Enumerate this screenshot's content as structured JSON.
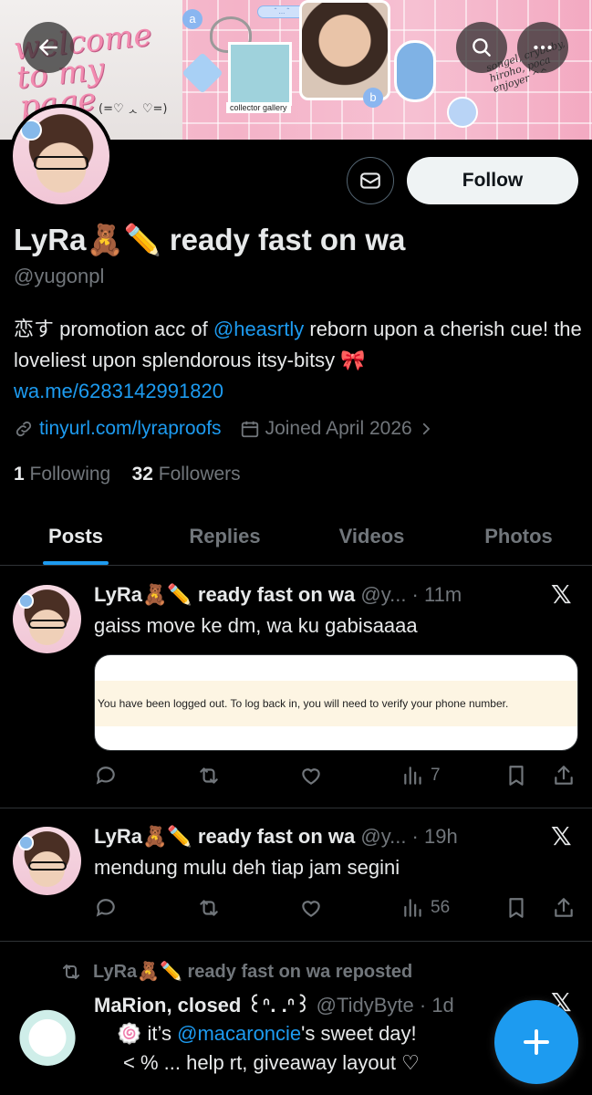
{
  "banner": {
    "script_text": "welcome to my page",
    "emoticon": "(=♡ ᆺ ♡=)",
    "sticker_text": "songel, crybaby, hiroho, poca enjoyer ^^",
    "caption": "collector gallery",
    "bubble_a": "a",
    "bubble_b": "b"
  },
  "profile": {
    "display_name": "LyRa🧸✏️ ready fast on wa",
    "handle": "@yugonpl",
    "follow_label": "Follow",
    "bio_prefix": "恋す promotion acc of ",
    "bio_mention": "@heasrtly",
    "bio_middle": " reborn upon a cherish cue! the loveliest upon splendorous itsy-bitsy 🎀",
    "bio_link": "wa.me/6283142991820",
    "website": "tinyurl.com/lyraproofs",
    "joined": "Joined April 2026",
    "following_count": "1",
    "following_label": "Following",
    "followers_count": "32",
    "followers_label": "Followers"
  },
  "tabs": [
    "Posts",
    "Replies",
    "Videos",
    "Photos"
  ],
  "tweets": [
    {
      "name": "LyRa🧸✏️ ready fast on wa",
      "handle_time": "@y... · 11m",
      "text": "gaiss move ke dm, wa ku gabisaaaa",
      "card_text": "You have been logged out. To log back in, you will need to verify your phone number.",
      "views": "7"
    },
    {
      "name": "LyRa🧸✏️ ready fast on wa",
      "handle_time": "@y... · 19h",
      "text": "mendung mulu deh tiap jam segini",
      "views": "56"
    },
    {
      "repost_label": "LyRa🧸✏️ ready fast on wa reposted",
      "name": "MaRion, closed ꒰ᐢ. .ᐢ꒱",
      "handle_time": "@TidyByte · 1d",
      "text_line1_prefix": "🍥 it’s ",
      "text_line1_mention": "@macaroncie",
      "text_line1_suffix": "'s sweet day!",
      "text_line2": "< % ... help rt, giveaway layout ♡"
    }
  ],
  "colors": {
    "accent": "#1d9bf0",
    "background": "#000000",
    "muted": "#71767b",
    "text": "#e7e9ea"
  }
}
